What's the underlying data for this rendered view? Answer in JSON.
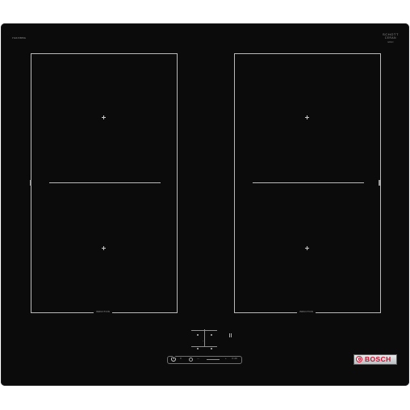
{
  "hob": {
    "model_code": "PIE645BB5E",
    "glass_brand_line1": "SCHOTT",
    "glass_brand_line2": "CERAN",
    "glass_brand_line3": "ERGO",
    "brand": "BOSCH",
    "brand_color": "#c8102e",
    "surface_color": "#0b0b0c",
    "line_color": "#b9b9b9"
  },
  "zones": {
    "left_label": "INDUCTION",
    "right_label": "INDUCTION",
    "left_side_mark": "COMBI",
    "right_side_mark": "COMBI"
  },
  "controls": {
    "power_icon": "power-icon",
    "timer_icon": "timer-icon",
    "minus_symbol": "—",
    "plus_symbol": "+",
    "timer_text": "0",
    "display_text": "⊙ 20",
    "panel_caption": "",
    "small_caption": "·"
  }
}
